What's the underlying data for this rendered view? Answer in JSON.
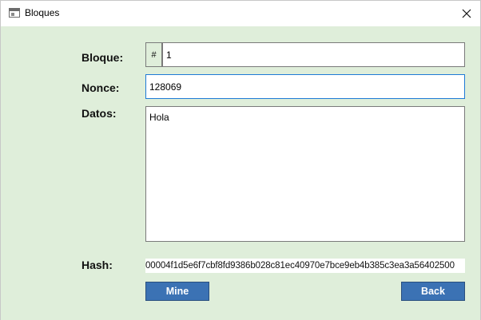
{
  "window": {
    "title": "Bloques",
    "icon": "app-window-icon",
    "close_icon": "close-icon"
  },
  "form": {
    "bloque_label": "Bloque:",
    "bloque_prefix": "#",
    "bloque_value": "1",
    "nonce_label": "Nonce:",
    "nonce_value": "128069",
    "datos_label": "Datos:",
    "datos_value": "Hola",
    "hash_label": "Hash:",
    "hash_value": "00004f1d5e6f7cbf8fd9386b028c81ec40970e7bce9eb4b385c3ea3a56402500"
  },
  "buttons": {
    "mine_label": "Mine",
    "back_label": "Back"
  },
  "colors": {
    "client_background": "#dfeeda",
    "button_background": "#3b72b4",
    "focus_border": "#1e7ad6"
  }
}
